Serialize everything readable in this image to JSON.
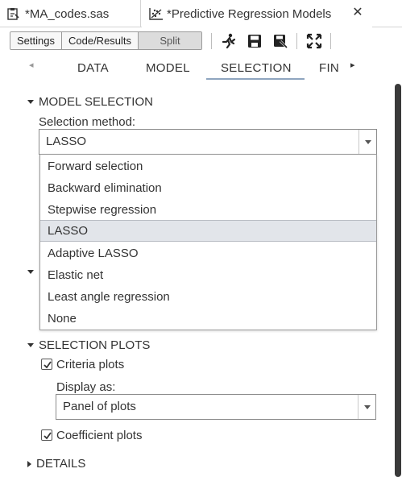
{
  "tabs": [
    {
      "label": "*MA_codes.sas",
      "icon": "sas-program-icon"
    },
    {
      "label": "*Predictive Regression Models",
      "icon": "regression-task-icon",
      "close_icon": "close-icon"
    }
  ],
  "toolbar": {
    "view_modes": [
      "Settings",
      "Code/Results",
      "Split"
    ],
    "active_view": "Split",
    "icons": [
      "run-icon",
      "save-icon",
      "save-as-icon",
      "maximize-icon"
    ]
  },
  "nav": {
    "tabs": [
      "DATA",
      "MODEL",
      "SELECTION",
      "FIN"
    ],
    "active": "SELECTION"
  },
  "model_selection": {
    "header": "MODEL SELECTION",
    "method_label": "Selection method:",
    "method_value": "LASSO",
    "options": [
      "Forward selection",
      "Backward elimination",
      "Stepwise regression",
      "LASSO",
      "Adaptive LASSO",
      "Elastic net",
      "Least angle regression",
      "None"
    ],
    "selected_option": "LASSO"
  },
  "selection_plots": {
    "header": "SELECTION PLOTS",
    "criteria_label": "Criteria plots",
    "criteria_checked": true,
    "display_as_label": "Display as:",
    "display_as_value": "Panel of plots",
    "coefficient_label": "Coefficient plots",
    "coefficient_checked": true
  },
  "details": {
    "header": "DETAILS"
  },
  "colors": {
    "accent_underline": "#8fa5bf",
    "selected_row": "#e2e5ea"
  }
}
